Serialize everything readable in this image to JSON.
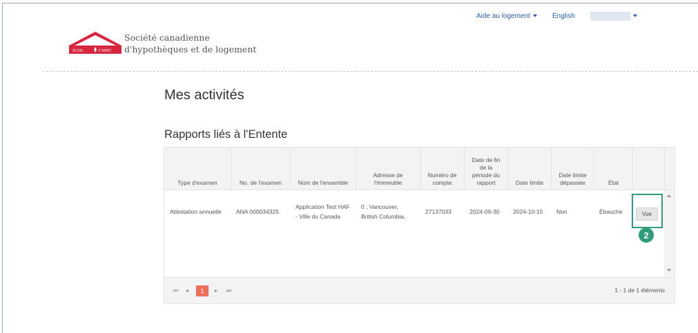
{
  "topnav": {
    "help_label": "Aide au logement",
    "language_label": "English"
  },
  "logo": {
    "org_line1": "Société canadienne",
    "org_line2": "d'hypothèques et de logement",
    "badge_left": "SCHL",
    "badge_right": "CMHC",
    "brand_color": "#d7263d"
  },
  "page": {
    "title": "Mes activités",
    "section_title": "Rapports liés à l'Entente"
  },
  "table": {
    "columns": [
      "Type d'examen",
      "No. de l'examen",
      "Nom de l'ensemble",
      "Adresse de l'immeuble",
      "Numéro de compte",
      "Date de fin de la période du rapport",
      "Date limite",
      "Date limite dépassée",
      "État",
      ""
    ],
    "rows": [
      {
        "type": "Attestation annuelle",
        "number": "ANA 000034325",
        "name": "Application Test HAF - Ville du Canada",
        "address": "0 , Vancouver, British Columbia,",
        "account": "27137033",
        "period_end": "2024-09-30",
        "deadline": "2024-10-15",
        "overdue": "Non",
        "status": "Ébauche",
        "action_label": "Vue"
      }
    ]
  },
  "pager": {
    "current_page": "1",
    "info": "1 - 1 de 1 éléments"
  },
  "annotation": {
    "step": "2",
    "color": "#2e9e7a"
  }
}
